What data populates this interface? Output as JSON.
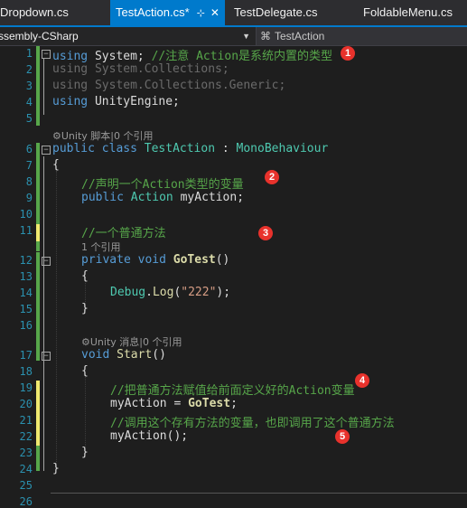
{
  "tabs": [
    {
      "label": "Dropdown.cs",
      "active": false
    },
    {
      "label": "TestAction.cs*",
      "active": true
    },
    {
      "label": "TestDelegate.cs",
      "active": false
    },
    {
      "label": "FoldableMenu.cs",
      "active": false
    }
  ],
  "tab_pin_icon": "pin-icon",
  "tab_close_icon": "close-icon",
  "nav": {
    "project": "ssembly-CSharp",
    "member": "TestAction",
    "dropdown_icon": "chevron-down-icon",
    "member_icon": "class-icon"
  },
  "code": {
    "l1": {
      "num": "1",
      "a": "using",
      "b": " System; ",
      "c": "//注意 Action是系统内置的类型"
    },
    "l2": {
      "num": "2",
      "a": "using",
      "b": " System.Collections;"
    },
    "l3": {
      "num": "3",
      "a": "using",
      "b": " System.Collections.Generic;"
    },
    "l4": {
      "num": "4",
      "a": "using",
      "b": " UnityEngine;"
    },
    "l5": {
      "num": "5"
    },
    "lens1": "Unity 脚本|0 个引用",
    "l6": {
      "num": "6",
      "a": "public",
      "b": " ",
      "c": "class",
      "d": " ",
      "e": "TestAction",
      "f": " : ",
      "g": "MonoBehaviour"
    },
    "l7": {
      "num": "7",
      "a": "{"
    },
    "l8": {
      "num": "8",
      "a": "//声明一个Action类型的变量"
    },
    "l9": {
      "num": "9",
      "a": "public",
      "b": " ",
      "c": "Action",
      "d": " myAction;"
    },
    "l10": {
      "num": "10"
    },
    "l11": {
      "num": "11",
      "a": "//一个普通方法"
    },
    "lens2": "1 个引用",
    "l12": {
      "num": "12",
      "a": "private",
      "b": " ",
      "c": "void",
      "d": " ",
      "e": "GoTest",
      "f": "()"
    },
    "l13": {
      "num": "13",
      "a": "{"
    },
    "l14": {
      "num": "14",
      "a": "Debug",
      "b": ".",
      "c": "Log",
      "d": "(",
      "e": "\"222\"",
      "f": ");"
    },
    "l15": {
      "num": "15",
      "a": "}"
    },
    "l16": {
      "num": "16"
    },
    "lens3": "Unity 消息|0 个引用",
    "l17": {
      "num": "17",
      "a": "void",
      "b": " ",
      "c": "Start",
      "d": "()"
    },
    "l18": {
      "num": "18",
      "a": "{"
    },
    "l19": {
      "num": "19",
      "a": "//把普通方法赋值给前面定义好的Action变量"
    },
    "l20": {
      "num": "20",
      "a": "myAction = ",
      "b": "GoTest",
      "c": ";"
    },
    "l21": {
      "num": "21",
      "a": "//调用这个存有方法的变量，也即调用了这个普通方法"
    },
    "l22": {
      "num": "22",
      "a": "myAction();"
    },
    "l23": {
      "num": "23",
      "a": "}"
    },
    "l24": {
      "num": "24",
      "a": "}"
    },
    "l25": {
      "num": "25"
    },
    "l26": {
      "num": "26"
    }
  },
  "lens_icon": "gear-icon",
  "annotations": [
    "1",
    "2",
    "3",
    "4",
    "5"
  ],
  "colors": {
    "keyword": "#569cd6",
    "type": "#4ec9b0",
    "comment": "#57a64a",
    "string": "#d69d85",
    "method": "#dcdcaa",
    "accent": "#007acc",
    "badge": "#e8322c"
  }
}
